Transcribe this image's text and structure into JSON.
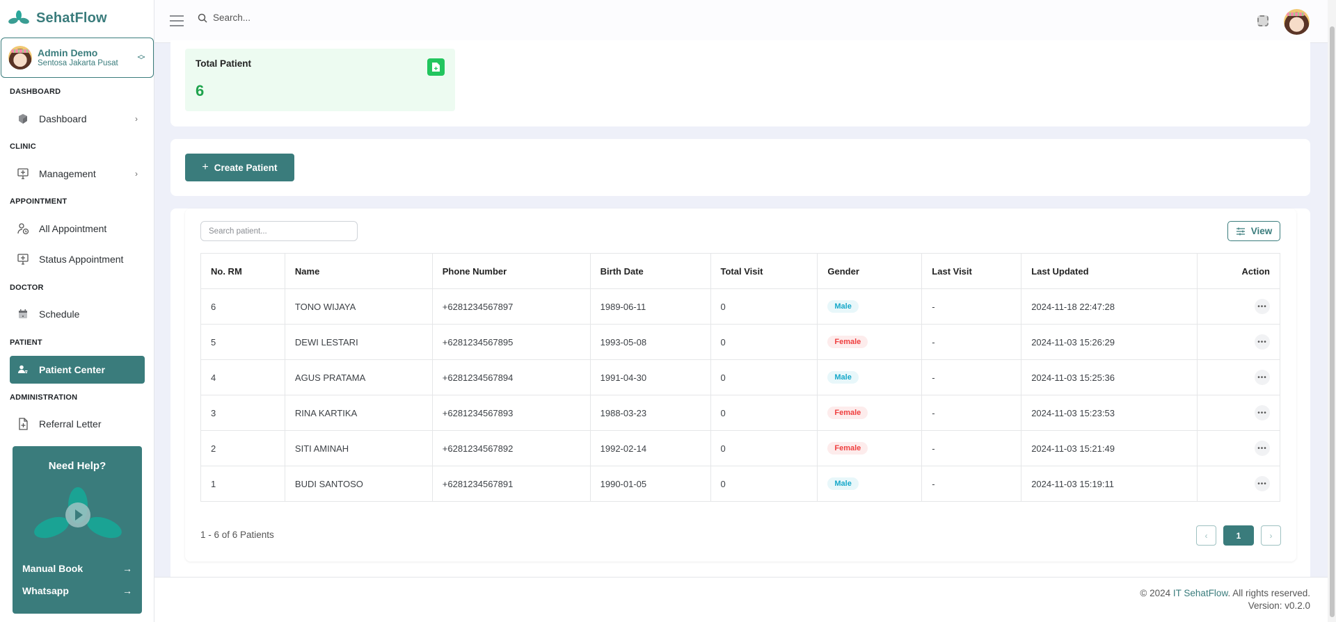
{
  "app": {
    "brand": "SehatFlow"
  },
  "user": {
    "name": "Admin Demo",
    "clinic": "Sentosa Jakarta Pusat"
  },
  "sidebar": {
    "sections": [
      {
        "label": "DASHBOARD",
        "items": [
          {
            "label": "Dashboard",
            "icon": "cube-icon",
            "has_chevron": true
          }
        ]
      },
      {
        "label": "CLINIC",
        "items": [
          {
            "label": "Management",
            "icon": "monitor-clinic-icon",
            "has_chevron": true
          }
        ]
      },
      {
        "label": "APPOINTMENT",
        "items": [
          {
            "label": "All Appointment",
            "icon": "user-clock-icon"
          },
          {
            "label": "Status Appointment",
            "icon": "monitor-clinic-icon"
          }
        ]
      },
      {
        "label": "DOCTOR",
        "items": [
          {
            "label": "Schedule",
            "icon": "calendar-icon"
          }
        ]
      },
      {
        "label": "PATIENT",
        "items": [
          {
            "label": "Patient Center",
            "icon": "patient-icon",
            "active": true
          }
        ]
      },
      {
        "label": "ADMINISTRATION",
        "items": [
          {
            "label": "Referral Letter",
            "icon": "file-plus-icon"
          }
        ]
      }
    ],
    "help": {
      "title": "Need Help?",
      "links": [
        {
          "label": "Manual Book",
          "arrow": "→"
        },
        {
          "label": "Whatsapp",
          "arrow": "→"
        }
      ]
    }
  },
  "topbar": {
    "search_placeholder": "Search..."
  },
  "stats": {
    "total_patient_label": "Total Patient",
    "total_patient_value": "6"
  },
  "actions": {
    "create_label": "Create Patient",
    "create_icon": "+"
  },
  "table": {
    "search_placeholder": "Search patient...",
    "view_label": "View",
    "columns": [
      "No. RM",
      "Name",
      "Phone Number",
      "Birth Date",
      "Total Visit",
      "Gender",
      "Last Visit",
      "Last Updated",
      "Action"
    ],
    "rows": [
      {
        "rm": "6",
        "name": "TONO WIJAYA",
        "phone": "+6281234567897",
        "birth": "1989-06-11",
        "visits": "0",
        "gender": "Male",
        "last_visit": "-",
        "updated": "2024-11-18 22:47:28"
      },
      {
        "rm": "5",
        "name": "DEWI LESTARI",
        "phone": "+6281234567895",
        "birth": "1993-05-08",
        "visits": "0",
        "gender": "Female",
        "last_visit": "-",
        "updated": "2024-11-03 15:26:29"
      },
      {
        "rm": "4",
        "name": "AGUS PRATAMA",
        "phone": "+6281234567894",
        "birth": "1991-04-30",
        "visits": "0",
        "gender": "Male",
        "last_visit": "-",
        "updated": "2024-11-03 15:25:36"
      },
      {
        "rm": "3",
        "name": "RINA KARTIKA",
        "phone": "+6281234567893",
        "birth": "1988-03-23",
        "visits": "0",
        "gender": "Female",
        "last_visit": "-",
        "updated": "2024-11-03 15:23:53"
      },
      {
        "rm": "2",
        "name": "SITI AMINAH",
        "phone": "+6281234567892",
        "birth": "1992-02-14",
        "visits": "0",
        "gender": "Female",
        "last_visit": "-",
        "updated": "2024-11-03 15:21:49"
      },
      {
        "rm": "1",
        "name": "BUDI SANTOSO",
        "phone": "+6281234567891",
        "birth": "1990-01-05",
        "visits": "0",
        "gender": "Male",
        "last_visit": "-",
        "updated": "2024-11-03 15:19:11"
      }
    ],
    "action_glyph": "•••"
  },
  "pagination": {
    "summary": "1 - 6 of 6 Patients",
    "current_page": "1",
    "prev": "‹",
    "next": "›"
  },
  "footer": {
    "prefix": "© 2024 ",
    "link": "IT SehatFlow",
    "suffix": ". All rights reserved.",
    "version": "Version: v0.2.0"
  },
  "colors": {
    "primary": "#3a7c7c",
    "success": "#22c55e",
    "male": "#17a8c9",
    "female": "#ef4040"
  }
}
